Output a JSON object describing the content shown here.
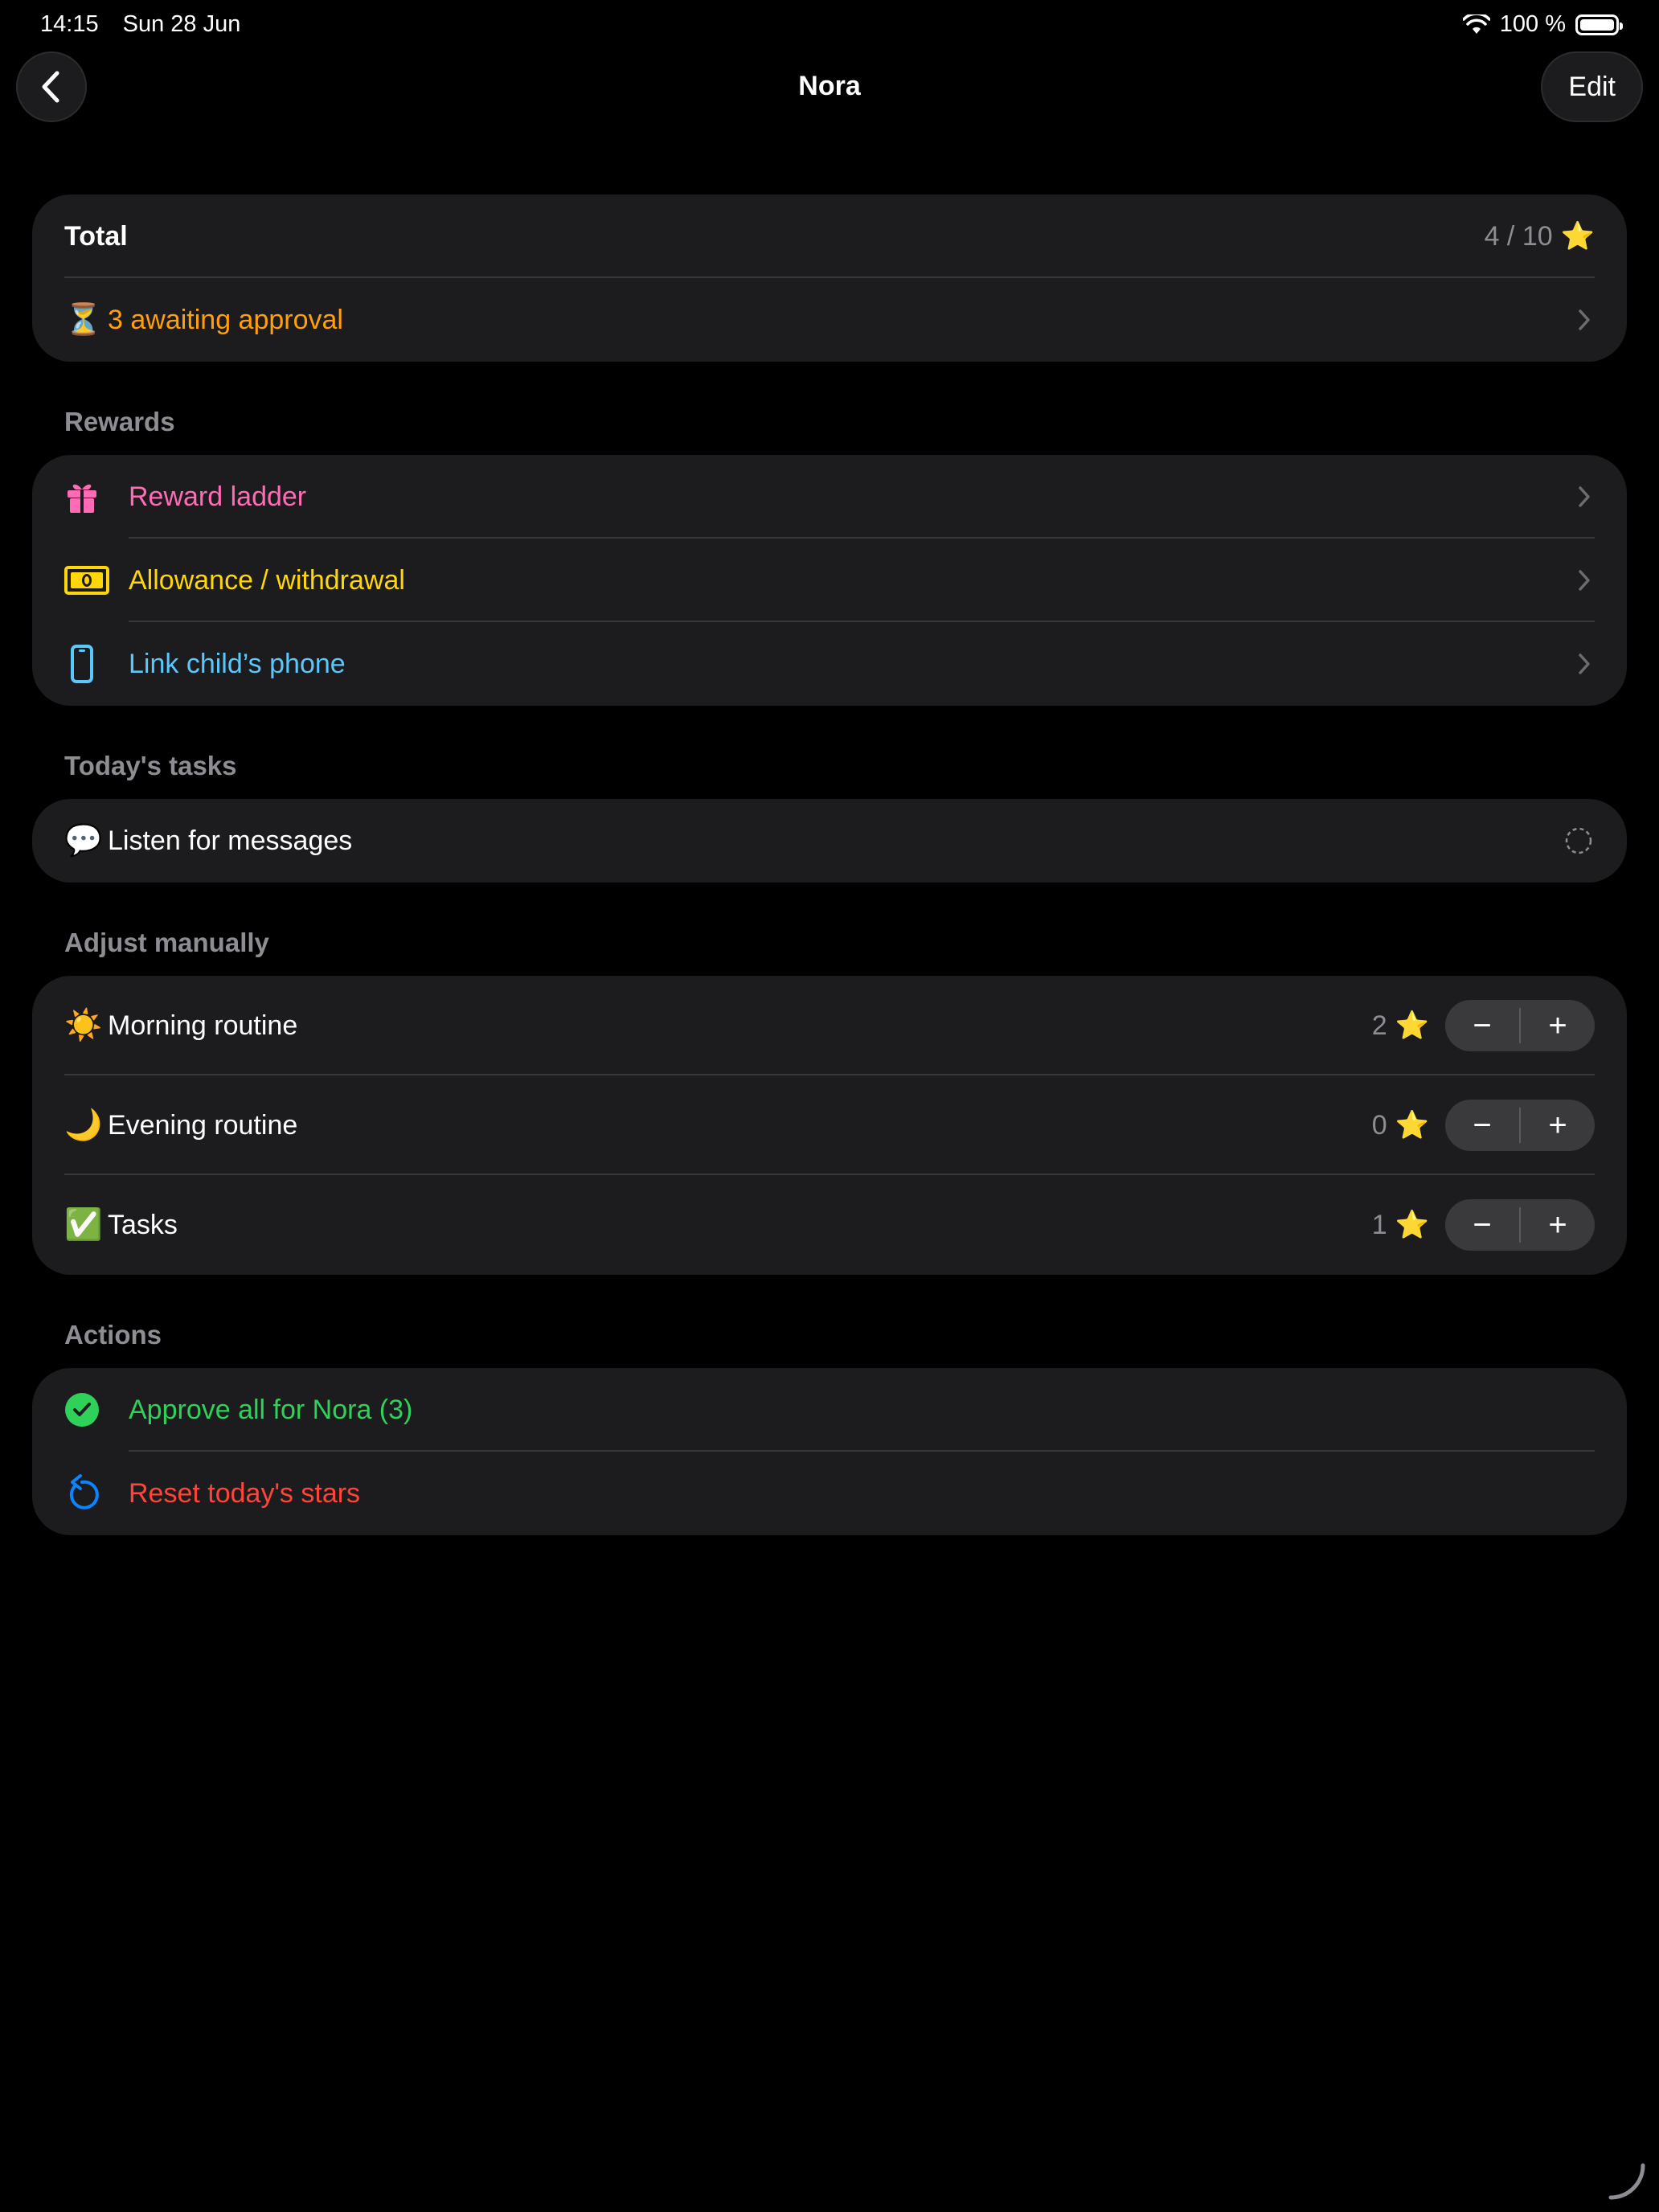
{
  "status_bar": {
    "time": "14:15",
    "date": "Sun 28 Jun",
    "battery_text": "100 %"
  },
  "nav": {
    "title": "Nora",
    "edit_label": "Edit"
  },
  "summary": {
    "total_label": "Total",
    "total_value": "4 / 10",
    "total_icon": "⭐",
    "pending_icon": "⏳",
    "pending_label": "3 awaiting approval",
    "pending_color": "#ff9f0a"
  },
  "rewards": {
    "header": "Rewards",
    "items": [
      {
        "label": "Reward ladder",
        "color": "#ff6bb5",
        "icon": "gift-icon"
      },
      {
        "label": "Allowance / withdrawal",
        "color": "#ffd60a",
        "icon": "banknote-icon"
      },
      {
        "label": "Link child’s phone",
        "color": "#5ac8fa",
        "icon": "phone-icon"
      }
    ]
  },
  "todays_tasks": {
    "header": "Today's tasks",
    "items": [
      {
        "emoji": "💬",
        "label": "Listen for messages"
      }
    ]
  },
  "adjust": {
    "header": "Adjust manually",
    "items": [
      {
        "emoji": "☀️",
        "label": "Morning routine",
        "value": "2",
        "star": "⭐"
      },
      {
        "emoji": "🌙",
        "label": "Evening routine",
        "value": "0",
        "star": "⭐"
      },
      {
        "emoji": "✅",
        "label": "Tasks",
        "value": "1",
        "star": "⭐"
      }
    ],
    "minus": "−",
    "plus": "+"
  },
  "actions": {
    "header": "Actions",
    "approve_label": "Approve all for Nora (3)",
    "approve_color": "#30d158",
    "reset_label": "Reset today's stars",
    "reset_color": "#ff453a"
  }
}
